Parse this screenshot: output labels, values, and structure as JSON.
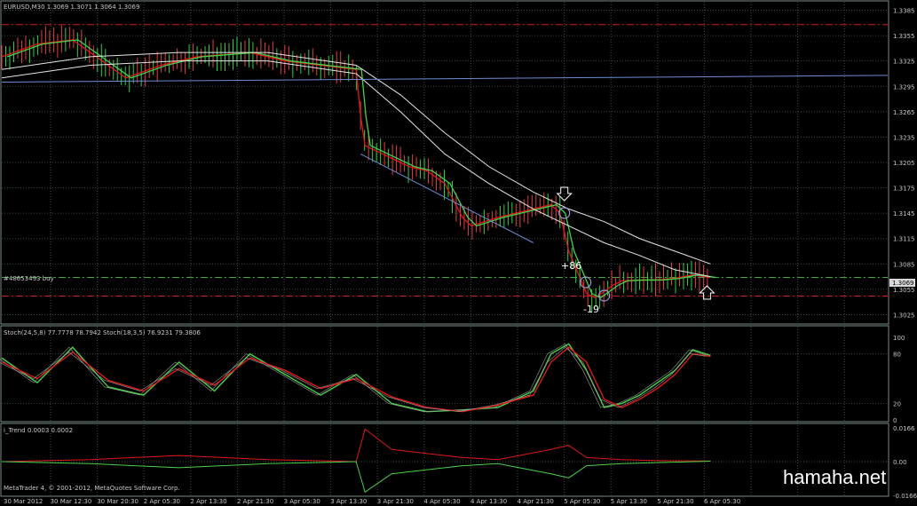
{
  "main": {
    "header": "EURUSD,M30  1.3069 1.3071 1.3064 1.3069",
    "order_label": "#48653493 buy",
    "current_price": "1.3069",
    "profit_label": "+86",
    "loss_label": "-19",
    "y_ticks": [
      "1.3385",
      "1.3355",
      "1.3325",
      "1.3295",
      "1.3265",
      "1.3235",
      "1.3205",
      "1.3175",
      "1.3145",
      "1.3115",
      "1.3085",
      "1.3055",
      "1.3025"
    ]
  },
  "stoch": {
    "header": "Stoch(24,5,8) 77.7778 78.7942  Stoch(18,3,5) 76.9231 79.3806",
    "y_ticks": [
      "100",
      "80",
      "20",
      "0"
    ]
  },
  "trend": {
    "header": "i_Trend 0.0003 0.0002",
    "y_ticks": [
      "0.0166",
      "0.00",
      "-0.0166"
    ]
  },
  "footer": {
    "copyright": "MetaTrader 4, © 2001-2012, MetaQuotes Software Corp.",
    "watermark": "hamaha.net"
  },
  "x_ticks": [
    "30 Mar 2012",
    "30 Mar 12:30",
    "30 Mar 20:30",
    "2 Apr 05:30",
    "2 Apr 13:30",
    "2 Apr 21:30",
    "3 Apr 05:30",
    "3 Apr 13:30",
    "3 Apr 21:30",
    "4 Apr 05:30",
    "4 Apr 13:30",
    "4 Apr 21:30",
    "5 Apr 05:30",
    "5 Apr 13:30",
    "5 Apr 21:30",
    "6 Apr 05:30"
  ],
  "colors": {
    "background": "#000000",
    "grid": "#3c4a44",
    "level_red": "#c81e1e",
    "level_green": "#3caa3c",
    "ma_white": "#e6e6e6",
    "fast_red": "#e01818",
    "fast_green": "#4ad04a",
    "blue_line": "#6c8cd2",
    "price_label_bg": "#d8d8d8"
  },
  "chart_data": [
    {
      "type": "line",
      "panel": "price",
      "ylim": [
        1.3015,
        1.3395
      ],
      "series": [
        {
          "key": "price_close",
          "x": [
            0,
            4,
            8,
            12,
            14,
            18,
            22,
            28,
            32,
            36,
            40,
            40.5,
            41,
            43,
            46,
            48,
            50,
            52,
            53,
            56,
            58,
            60,
            62,
            63,
            64,
            66,
            67,
            69,
            70,
            72,
            74,
            76,
            78,
            80
          ],
          "values": [
            1.333,
            1.3345,
            1.335,
            1.332,
            1.3305,
            1.332,
            1.333,
            1.3335,
            1.3325,
            1.332,
            1.3315,
            1.326,
            1.3225,
            1.3215,
            1.32,
            1.3195,
            1.318,
            1.314,
            1.313,
            1.314,
            1.3145,
            1.315,
            1.3155,
            1.3145,
            1.31,
            1.305,
            1.3045,
            1.306,
            1.3065,
            1.3066,
            1.3066,
            1.3068,
            1.3072,
            1.3069
          ]
        },
        {
          "key": "ma_slow",
          "x": [
            0,
            10,
            20,
            30,
            40,
            45,
            50,
            55,
            60,
            64,
            68,
            72,
            76,
            80
          ],
          "values": [
            1.3315,
            1.333,
            1.3335,
            1.3335,
            1.332,
            1.3285,
            1.324,
            1.32,
            1.317,
            1.315,
            1.3135,
            1.3115,
            1.31,
            1.3085
          ]
        },
        {
          "key": "ma_mid",
          "x": [
            0,
            10,
            20,
            30,
            40,
            45,
            50,
            55,
            60,
            64,
            68,
            72,
            76,
            80
          ],
          "values": [
            1.3305,
            1.332,
            1.3325,
            1.3325,
            1.331,
            1.3265,
            1.3215,
            1.318,
            1.315,
            1.313,
            1.311,
            1.3095,
            1.3078,
            1.307
          ]
        },
        {
          "key": "horizontal_blue",
          "x": [
            0,
            100
          ],
          "values": [
            1.33,
            1.3308
          ]
        },
        {
          "key": "channel_blue",
          "x": [
            40.5,
            60
          ],
          "values": [
            1.3215,
            1.311
          ]
        }
      ],
      "levels": [
        1.3368,
        1.3047,
        1.3069
      ]
    },
    {
      "type": "line",
      "panel": "stoch",
      "ylim": [
        0,
        100
      ],
      "series": [
        {
          "key": "stoch_fast_green",
          "x": [
            0,
            4,
            8,
            12,
            16,
            20,
            24,
            28,
            32,
            36,
            40,
            44,
            48,
            52,
            56,
            60,
            62,
            64,
            66,
            68,
            70,
            72,
            74,
            76,
            78,
            80
          ],
          "values": [
            75,
            45,
            88,
            40,
            30,
            70,
            35,
            80,
            55,
            30,
            55,
            20,
            10,
            12,
            15,
            35,
            80,
            92,
            60,
            15,
            20,
            30,
            45,
            60,
            85,
            78
          ]
        },
        {
          "key": "stoch_slow_red",
          "x": [
            0,
            4,
            8,
            12,
            16,
            20,
            24,
            28,
            32,
            36,
            40,
            44,
            48,
            52,
            56,
            60,
            62,
            64,
            66,
            68,
            70,
            72,
            74,
            76,
            78,
            80
          ],
          "values": [
            70,
            50,
            82,
            48,
            35,
            62,
            42,
            75,
            60,
            38,
            50,
            28,
            15,
            10,
            18,
            30,
            70,
            88,
            70,
            25,
            15,
            25,
            38,
            55,
            80,
            77
          ]
        }
      ]
    },
    {
      "type": "line",
      "panel": "trend",
      "ylim": [
        -0.0166,
        0.0166
      ],
      "series": [
        {
          "key": "trend_red",
          "x": [
            0,
            10,
            20,
            30,
            40,
            41,
            44,
            48,
            52,
            56,
            62,
            64,
            66,
            70,
            74,
            80
          ],
          "values": [
            0.0,
            0.001,
            0.003,
            0.001,
            0.0,
            0.016,
            0.006,
            0.004,
            0.002,
            0.001,
            0.006,
            0.008,
            0.002,
            0.001,
            0.0005,
            0.0003
          ]
        },
        {
          "key": "trend_green",
          "x": [
            0,
            10,
            20,
            30,
            40,
            41,
            44,
            48,
            52,
            56,
            62,
            64,
            66,
            70,
            74,
            80
          ],
          "values": [
            0.0,
            -0.001,
            -0.003,
            -0.001,
            0.0,
            -0.015,
            -0.006,
            -0.004,
            -0.002,
            -0.001,
            -0.006,
            -0.008,
            -0.002,
            -0.001,
            -0.0005,
            0.0002
          ]
        }
      ]
    }
  ]
}
